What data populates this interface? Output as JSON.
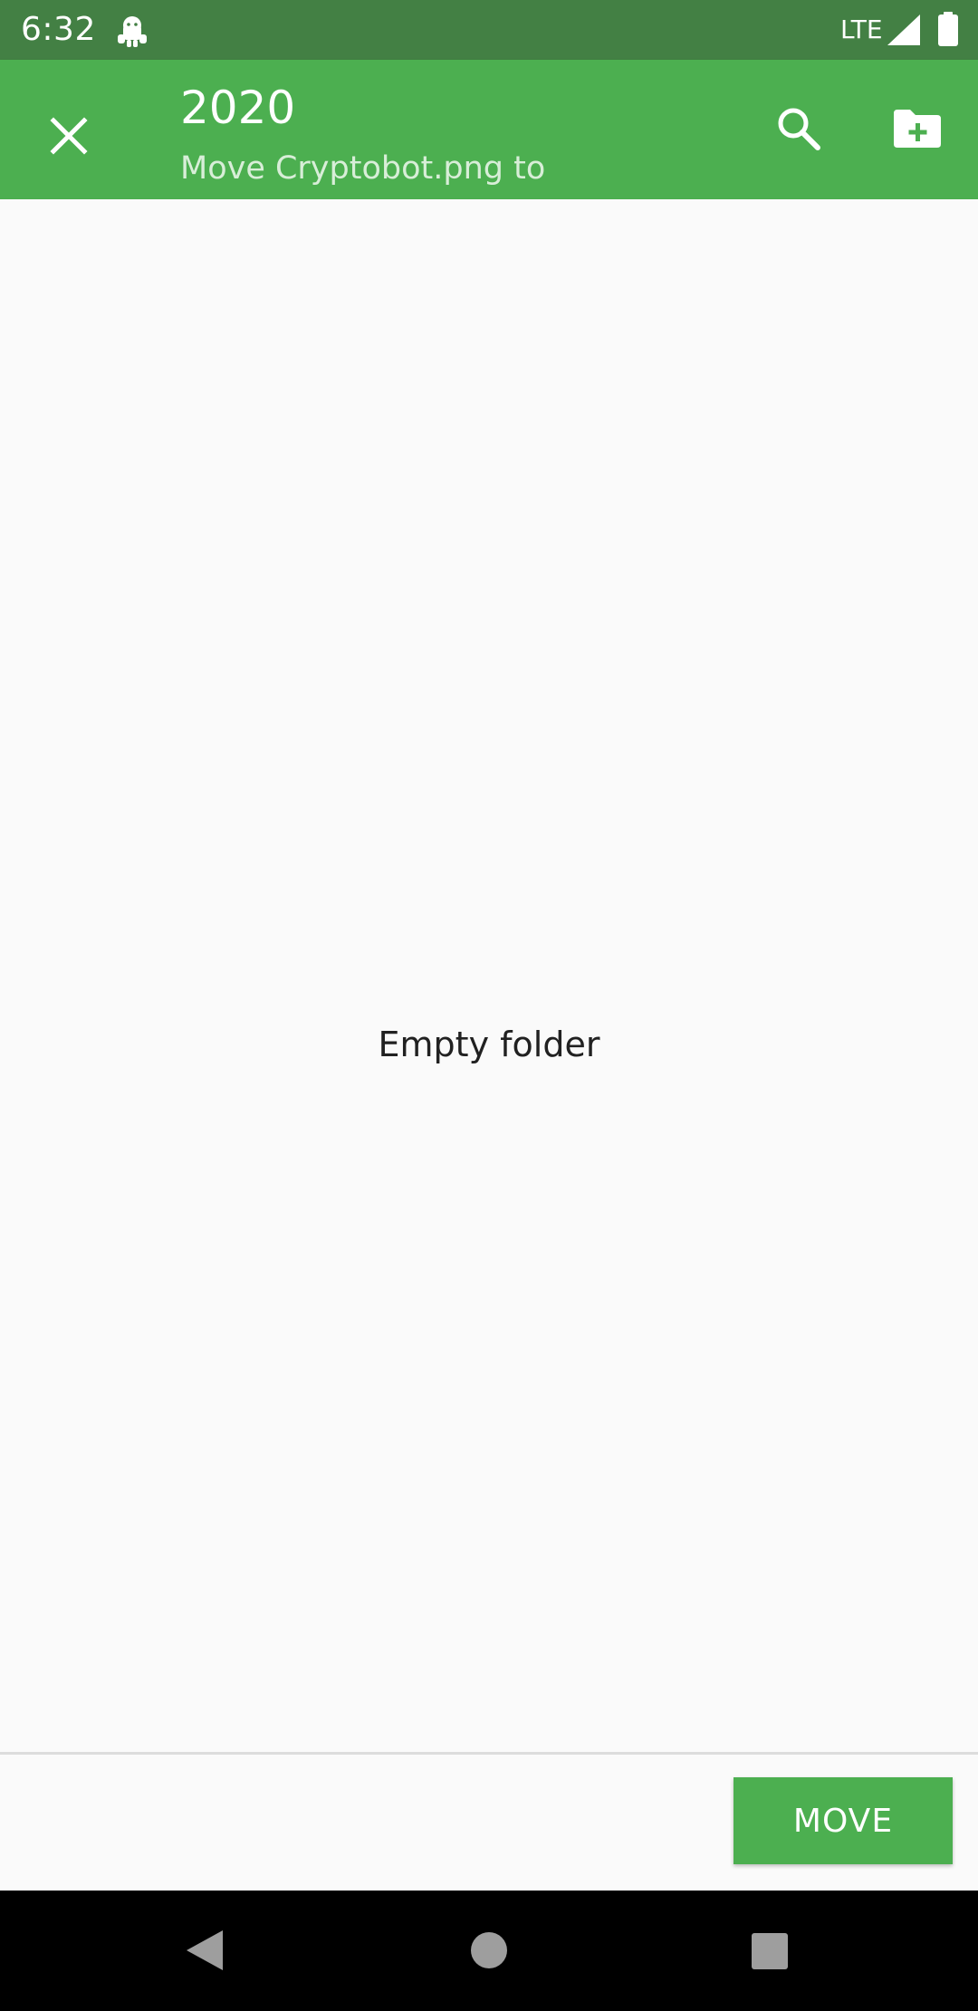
{
  "status_bar": {
    "time": "6:32",
    "network": "LTE",
    "notification_icon": "android-robot-icon",
    "signal_icon": "signal-icon",
    "battery_icon": "battery-icon"
  },
  "app_bar": {
    "title": "2020",
    "subtitle": "Move Cryptobot.png to",
    "close_icon": "close-icon",
    "search_icon": "search-icon",
    "new_folder_icon": "new-folder-icon",
    "background_color": "#4caf50"
  },
  "content": {
    "empty_message": "Empty folder"
  },
  "bottom_bar": {
    "move_label": "MOVE"
  },
  "nav_bar": {
    "back_icon": "back-icon",
    "home_icon": "home-icon",
    "recents_icon": "recents-icon"
  },
  "colors": {
    "status_bar": "#438044",
    "accent": "#4caf50",
    "background": "#fafafa",
    "nav_bar": "#000000"
  }
}
